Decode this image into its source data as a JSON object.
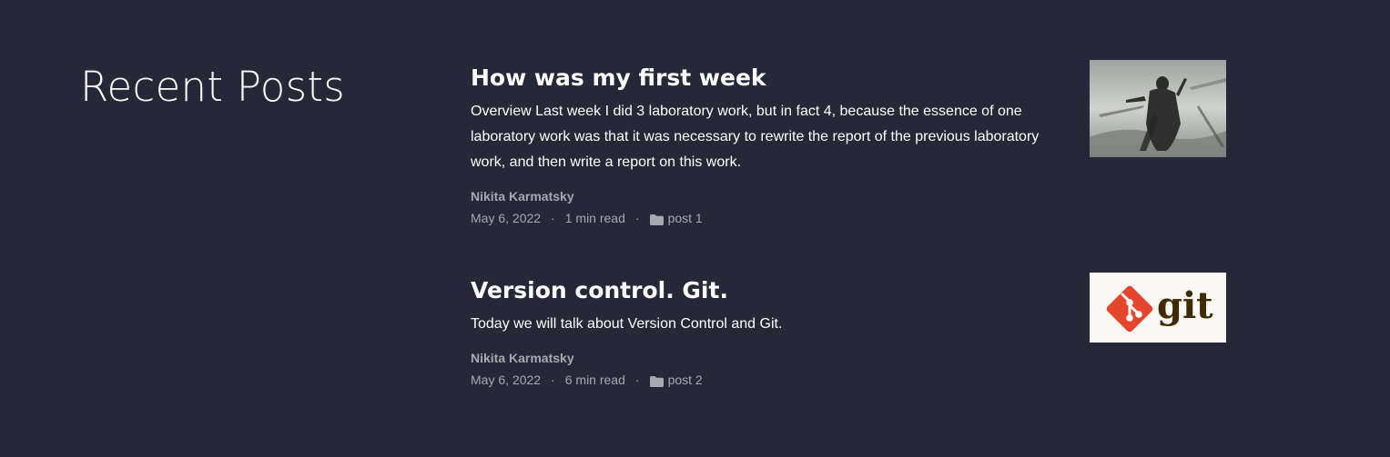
{
  "section": {
    "title": "Recent Posts"
  },
  "posts": [
    {
      "title": "How was my first week",
      "excerpt": "Overview Last week I did 3 laboratory work, but in fact 4, because the essence of one laboratory work was that it was necessary to rewrite the report of the previous laboratory work, and then write a report on this work.",
      "author": "Nikita Karmatsky",
      "date": "May 6, 2022",
      "read_time": "1 min read",
      "category": "post 1",
      "thumbnail_icon": "lone-wanderer-photo"
    },
    {
      "title": "Version control. Git.",
      "excerpt": "Today we will talk about Version Control and Git.",
      "author": "Nikita Karmatsky",
      "date": "May 6, 2022",
      "read_time": "6 min read",
      "category": "post 2",
      "thumbnail_icon": "git-logo",
      "thumbnail_logo_text": "git"
    }
  ],
  "meta": {
    "separator": "·"
  },
  "colors": {
    "background": "#262837",
    "text": "#ffffff",
    "muted": "#a8a8b0",
    "git_red": "#e4452c",
    "git_dark": "#3e2c00"
  }
}
